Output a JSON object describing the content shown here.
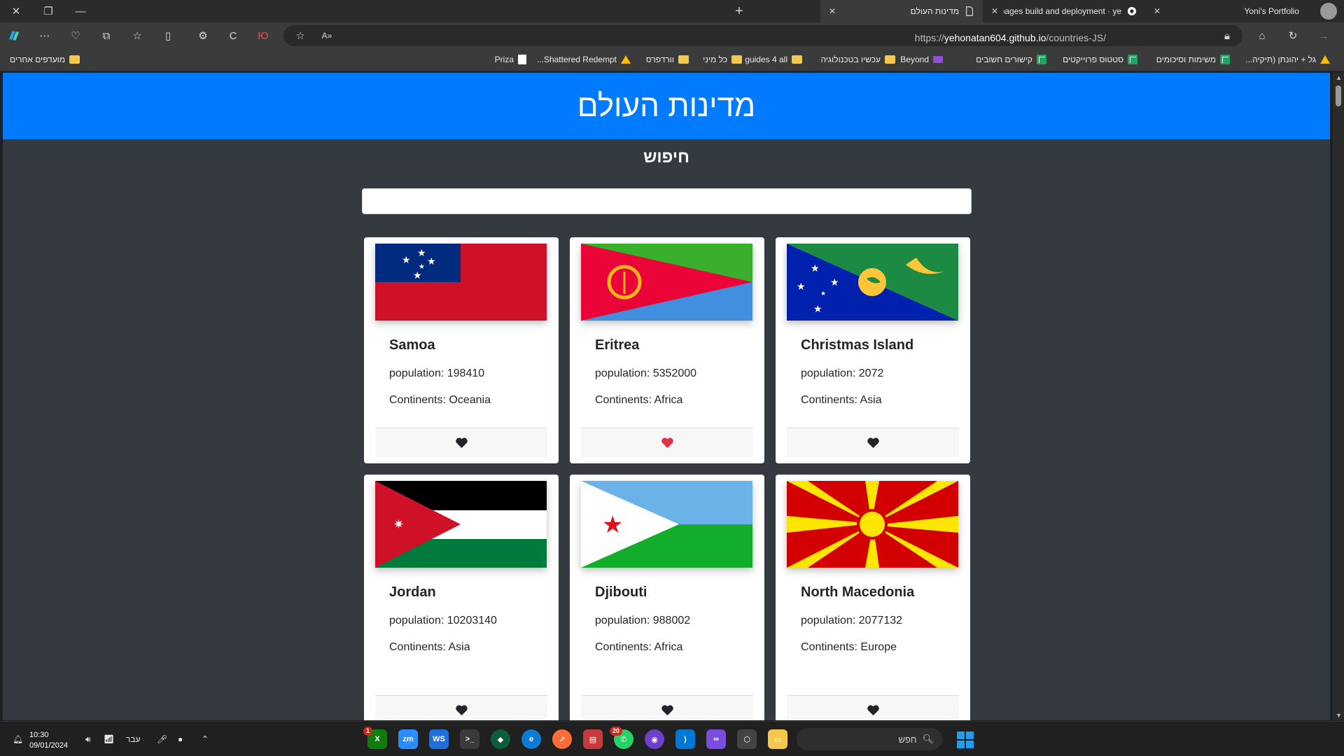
{
  "browser": {
    "tabs": [
      {
        "title": "Yoni's Portfolio"
      },
      {
        "title": "pages build and deployment · ye"
      },
      {
        "title": "מדינות העולם"
      }
    ],
    "url_prefix": "https://",
    "url_host": "yehonatan604.github.io",
    "url_path": "/countries-JS/",
    "bookmarks": [
      {
        "label": "גל + יהונתן (תיקיה...",
        "icon": "drive-icon"
      },
      {
        "label": "משימות וסיכומים",
        "icon": "sheet-icon"
      },
      {
        "label": "סטטוס פרוייקטים",
        "icon": "sheet-icon"
      },
      {
        "label": "קישורים חשובים",
        "icon": "sheet-icon"
      },
      {
        "label": "Beyond",
        "icon": "folder-icon"
      },
      {
        "label": "עכשיו בטכנולוגיה",
        "icon": "folder-icon"
      },
      {
        "label": "guides 4 all",
        "icon": "folder-icon"
      },
      {
        "label": "כל מיני",
        "icon": "folder-icon"
      },
      {
        "label": "וורדפרס",
        "icon": "folder-icon"
      },
      {
        "label": "Shattered Redempt...",
        "icon": "drive-icon"
      },
      {
        "label": "Priza",
        "icon": "doc-icon"
      }
    ],
    "other_bookmarks": "מועדפים אחרים"
  },
  "page": {
    "title": "מדינות העולם",
    "search_label": "חיפוש",
    "search_value": "",
    "population_label": "population:",
    "continents_label": "Continents:"
  },
  "countries": [
    {
      "name": "Samoa",
      "population": "198410",
      "continents": "Oceania",
      "favorite": false,
      "flag": "samoa"
    },
    {
      "name": "Eritrea",
      "population": "5352000",
      "continents": "Africa",
      "favorite": true,
      "flag": "eritrea"
    },
    {
      "name": "Christmas Island",
      "population": "2072",
      "continents": "Asia",
      "favorite": false,
      "flag": "christmas-island"
    },
    {
      "name": "Jordan",
      "population": "10203140",
      "continents": "Asia",
      "favorite": false,
      "flag": "jordan"
    },
    {
      "name": "Djibouti",
      "population": "988002",
      "continents": "Africa",
      "favorite": false,
      "flag": "djibouti"
    },
    {
      "name": "North Macedonia",
      "population": "2077132",
      "continents": "Europe",
      "favorite": false,
      "flag": "north-macedonia"
    }
  ],
  "colors": {
    "hero": "#007bff",
    "page_bg": "#343a40",
    "heart_default": "#212529",
    "heart_favorite": "#dc3545"
  },
  "taskbar": {
    "time": "10:30",
    "date": "09/01/2024",
    "language": "עבר",
    "search_placeholder": "חפש",
    "badge_xbox": "1",
    "badge_whatsapp": "20"
  }
}
